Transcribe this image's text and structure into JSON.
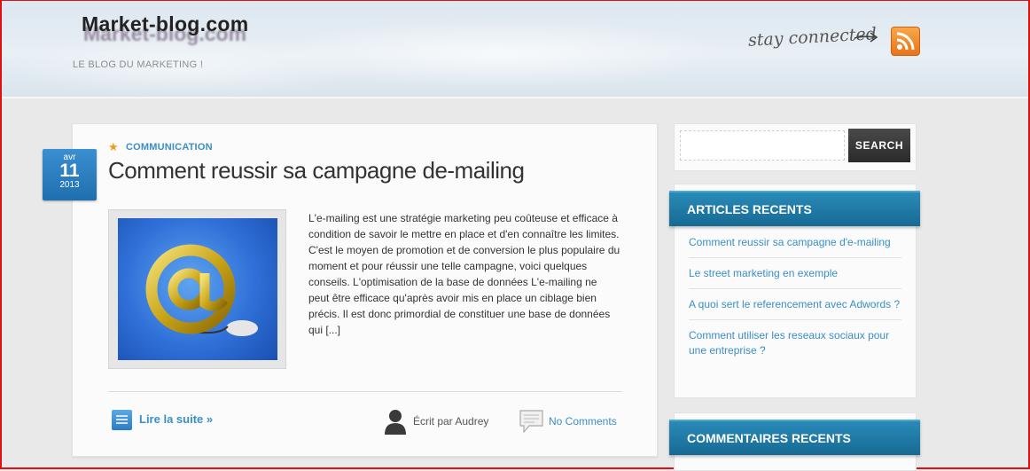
{
  "site": {
    "logo": "Market-blog.com",
    "tagline": "LE BLOG DU MARKETING !",
    "stay_connected": "stay connected"
  },
  "post": {
    "date": {
      "month": "avr",
      "day": "11",
      "year": "2013"
    },
    "category": "COMMUNICATION",
    "title": "Comment reussir sa campagne de-mailing",
    "excerpt": "L'e-mailing est une stratégie marketing peu coûteuse et efficace à condition de savoir le mettre en place et d'en connaître les limites. C'est le moyen de promotion et de conversion le plus populaire du moment et pour réussir une telle campagne, voici quelques conseils. L'optimisation de la base de données L'e-mailing ne peut être efficace qu'après avoir mis en place un ciblage bien précis. Il est donc primordial de constituer une base de données qui [...]",
    "read_more": "Lire la suite »",
    "author": "Écrit par Audrey",
    "comments": "No Comments"
  },
  "sidebar": {
    "search_button": "SEARCH",
    "search_placeholder": "",
    "recent_title": "ARTICLES RECENTS",
    "recent_items": [
      "Comment reussir sa campagne d'e-mailing",
      "Le street marketing en exemple",
      "A quoi sert le referencement avec Adwords ?",
      "Comment utiliser les reseaux sociaux pour une entreprise ?"
    ],
    "comments_title": "COMMENTAIRES RECENTS"
  },
  "colors": {
    "accent": "#3a8fc8",
    "widget_header": "#1e7aa6",
    "rss": "#f08a24"
  }
}
